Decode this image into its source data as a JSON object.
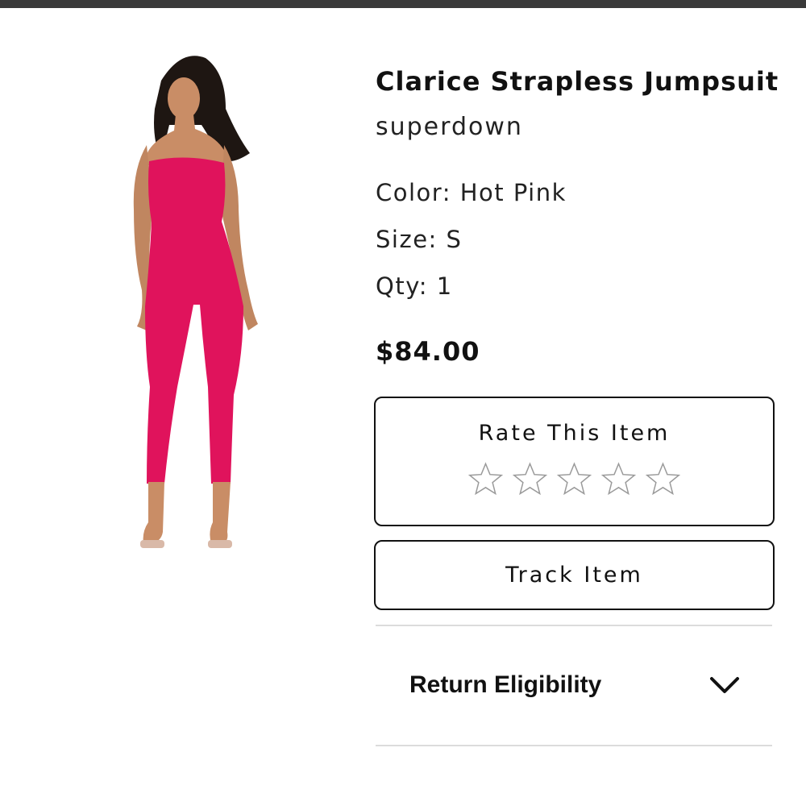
{
  "product": {
    "title": "Clarice Strapless Jumpsuit",
    "brand": "superdown",
    "color": "Color: Hot Pink",
    "size": "Size: S",
    "qty": "Qty: 1",
    "price": "$84.00",
    "garment_color": "#e0135c"
  },
  "rating": {
    "title": "Rate This Item",
    "max_stars": 5,
    "current_rating": 0
  },
  "track": {
    "label": "Track Item"
  },
  "return_eligibility": {
    "label": "Return Eligibility",
    "icon": "chevron-down-icon"
  }
}
